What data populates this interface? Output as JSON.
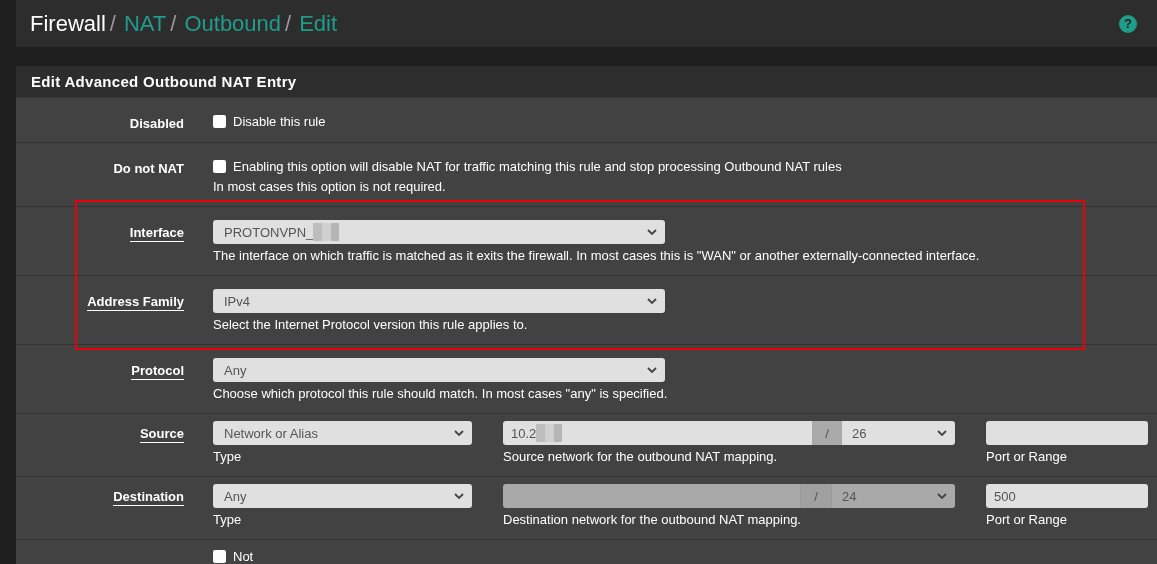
{
  "breadcrumb": [
    {
      "label": "Firewall",
      "link": false
    },
    {
      "separator": "/",
      "label": "NAT",
      "link": true
    },
    {
      "separator": "/",
      "label": "Outbound",
      "link": true
    },
    {
      "separator": "/",
      "label": "Edit",
      "link": true
    }
  ],
  "help_button": "?",
  "panel": {
    "title": "Edit Advanced Outbound NAT Entry"
  },
  "rows": [
    {
      "kind": "checkbox",
      "label": "Disabled",
      "link": false,
      "highlighted": false,
      "checkbox": {
        "checked": false,
        "text": "Disable this rule"
      }
    },
    {
      "kind": "checkbox",
      "label": "Do not NAT",
      "link": false,
      "highlighted": false,
      "checkbox": {
        "checked": false,
        "text": "Enabling this option will disable NAT for traffic matching this rule and stop processing Outbound NAT rules"
      },
      "help": "In most cases this option is not required."
    },
    {
      "kind": "select",
      "label": "Interface",
      "link": true,
      "highlighted": true,
      "select": {
        "value": "PROTONVPN_",
        "redacted": true
      },
      "help": "The interface on which traffic is matched as it exits the firewall. In most cases this is \"WAN\" or another externally-connected interface."
    },
    {
      "kind": "select",
      "label": "Address Family",
      "link": true,
      "highlighted": true,
      "select": {
        "value": "IPv4",
        "redacted": false
      },
      "help": "Select the Internet Protocol version this rule applies to."
    },
    {
      "kind": "select",
      "label": "Protocol",
      "link": true,
      "highlighted": false,
      "select": {
        "value": "Any",
        "redacted": false
      },
      "help": "Choose which protocol this rule should match. In most cases \"any\" is specified."
    },
    {
      "kind": "endpoint",
      "label": "Source",
      "link": true,
      "highlighted": false,
      "type": {
        "value": "Network or Alias",
        "caption": "Type"
      },
      "network": {
        "value": "10.2",
        "redacted": true,
        "disabled": false,
        "separator": "/",
        "mask": "26",
        "caption": "Source network for the outbound NAT mapping."
      },
      "port": {
        "caption": "Port or Range"
      }
    },
    {
      "kind": "endpoint",
      "label": "Destination",
      "link": true,
      "highlighted": false,
      "type": {
        "value": "Any",
        "caption": "Type"
      },
      "network": {
        "redacted": false,
        "disabled": true,
        "separator": "/",
        "mask": "24",
        "caption": "Destination network for the outbound NAT mapping."
      },
      "port": {
        "value": "500",
        "caption": "Port or Range"
      }
    },
    {
      "kind": "checkbox",
      "highlighted": false,
      "checkbox": {
        "checked": false,
        "text": "Not"
      }
    }
  ]
}
